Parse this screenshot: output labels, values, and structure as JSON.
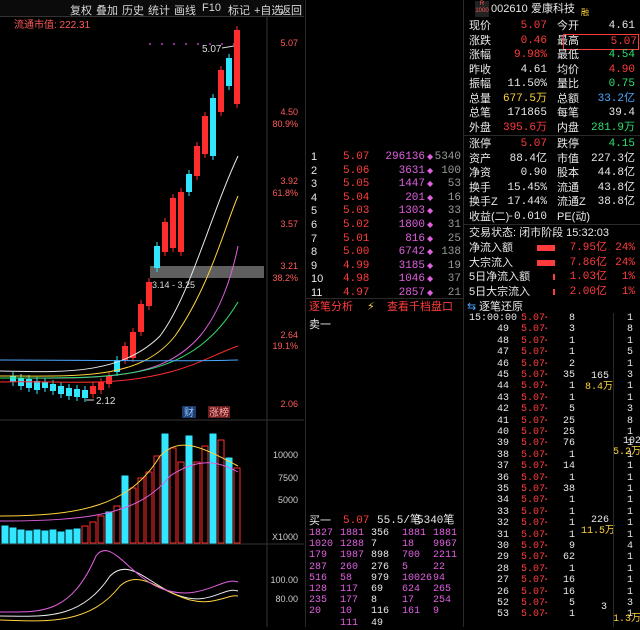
{
  "toolbar": {
    "items": [
      "复权",
      "叠加",
      "历史",
      "统计",
      "画线",
      "F10",
      "标记",
      "+自选",
      "返回"
    ]
  },
  "chart": {
    "market_cap_label": "流通市值: 222.31",
    "price_axis": [
      "5.07",
      "4.50",
      "3.92",
      "3.57",
      "3.21",
      "2.64",
      "2.06"
    ],
    "pct_axis": [
      "80.9%",
      "61.8%",
      "38.2%",
      "19.1%"
    ],
    "high_label": "5.07",
    "low_label": "2.12",
    "range_label": "3.14 - 3.25",
    "badges": [
      "财",
      "涨榜"
    ],
    "vol_axis": [
      "10000",
      "7500",
      "5000"
    ],
    "vol_unit": "X1000",
    "ind_axis": [
      "100.00",
      "80.00"
    ]
  },
  "stock": {
    "code": "002610",
    "name": "爱康科技",
    "badge_r": "R",
    "badge_code": "1000",
    "badge_rong": "融"
  },
  "quote": {
    "rows": [
      [
        {
          "k": "现价",
          "v": "5.07",
          "c": "r"
        },
        {
          "k": "今开",
          "v": "4.61",
          "c": "w"
        }
      ],
      [
        {
          "k": "涨跌",
          "v": "0.46",
          "c": "r"
        },
        {
          "k": "最高",
          "v": "5.07",
          "c": "r",
          "box": true
        }
      ],
      [
        {
          "k": "涨幅",
          "v": "9.98%",
          "c": "r"
        },
        {
          "k": "最低",
          "v": "4.54",
          "c": "g"
        }
      ],
      [
        {
          "k": "昨收",
          "v": "4.61",
          "c": "w"
        },
        {
          "k": "均价",
          "v": "4.90",
          "c": "r"
        }
      ],
      [
        {
          "k": "振幅",
          "v": "11.50%",
          "c": "w"
        },
        {
          "k": "量比",
          "v": "0.75",
          "c": "g"
        }
      ],
      [
        {
          "k": "总量",
          "v": "677.5万",
          "c": "y"
        },
        {
          "k": "总额",
          "v": "33.2亿",
          "c": "b"
        }
      ],
      [
        {
          "k": "总笔",
          "v": "171865",
          "c": "w"
        },
        {
          "k": "每笔",
          "v": "39.4",
          "c": "w"
        }
      ],
      [
        {
          "k": "外盘",
          "v": "395.6万",
          "c": "r"
        },
        {
          "k": "内盘",
          "v": "281.9万",
          "c": "g"
        }
      ]
    ],
    "rows2": [
      [
        {
          "k": "涨停",
          "v": "5.07",
          "c": "r"
        },
        {
          "k": "跌停",
          "v": "4.15",
          "c": "g"
        }
      ],
      [
        {
          "k": "资产",
          "v": "88.4亿",
          "c": "w"
        },
        {
          "k": "市值",
          "v": "227.3亿",
          "c": "w"
        }
      ],
      [
        {
          "k": "净资",
          "v": "0.90",
          "c": "w"
        },
        {
          "k": "股本",
          "v": "44.8亿",
          "c": "w"
        }
      ],
      [
        {
          "k": "换手",
          "v": "15.45%",
          "c": "w"
        },
        {
          "k": "流通",
          "v": "43.8亿",
          "c": "w"
        }
      ],
      [
        {
          "k": "换手Z",
          "v": "17.44%",
          "c": "w"
        },
        {
          "k": "流通Z",
          "v": "38.8亿",
          "c": "w"
        }
      ],
      [
        {
          "k": "收益(二)",
          "v": "-0.010",
          "c": "w"
        },
        {
          "k": "PE(动)",
          "v": "",
          "c": "w"
        }
      ]
    ],
    "status": "交易状态: 闭市阶段 15:32:03",
    "flows": [
      {
        "k": "净流入额",
        "v": "7.95亿",
        "p": "24%",
        "bar": 0.9
      },
      {
        "k": "大宗流入",
        "v": "7.86亿",
        "p": "24%",
        "bar": 0.9
      },
      {
        "k": "5日净流入额",
        "v": "1.03亿",
        "p": "1%",
        "bar": 0.12
      },
      {
        "k": "5日大宗流入",
        "v": "2.00亿",
        "p": "1%",
        "bar": 0.12
      }
    ]
  },
  "buy_book": [
    {
      "lv": "1",
      "p": "5.07",
      "v": "296136",
      "x": "5340"
    },
    {
      "lv": "2",
      "p": "5.06",
      "v": "3631",
      "x": "100"
    },
    {
      "lv": "3",
      "p": "5.05",
      "v": "1447",
      "x": "53"
    },
    {
      "lv": "4",
      "p": "5.04",
      "v": "201",
      "x": "16"
    },
    {
      "lv": "5",
      "p": "5.03",
      "v": "1303",
      "x": "33"
    },
    {
      "lv": "6",
      "p": "5.02",
      "v": "1800",
      "x": "31"
    },
    {
      "lv": "7",
      "p": "5.01",
      "v": "816",
      "x": "25"
    },
    {
      "lv": "8",
      "p": "5.00",
      "v": "6742",
      "x": "138"
    },
    {
      "lv": "9",
      "p": "4.99",
      "v": "3185",
      "x": "19"
    },
    {
      "lv": "10",
      "p": "4.98",
      "v": "1046",
      "x": "37"
    },
    {
      "lv": "11",
      "p": "4.97",
      "v": "2857",
      "x": "21"
    }
  ],
  "tabs": {
    "tick_analysis": "逐笔分析",
    "depth": "查看千档盘口",
    "sell1": "卖一",
    "tick_restore": "逐笔还原"
  },
  "buy1": {
    "label": "买一",
    "price": "5.07",
    "avg": "55.5/笔",
    "count": "5340笔"
  },
  "queue": [
    [
      "1827",
      "1881",
      "356",
      "1881",
      "1881"
    ],
    [
      "1020",
      "1288",
      "7",
      "18",
      "9967"
    ],
    [
      "179",
      "1987",
      "898",
      "700",
      "2211"
    ],
    [
      "287",
      "260",
      "276",
      "5",
      "22"
    ],
    [
      "516",
      "58",
      "979",
      "10026",
      "94"
    ],
    [
      "128",
      "117",
      "69",
      "624",
      "265"
    ],
    [
      "235",
      "177",
      "8",
      "17",
      "254"
    ],
    [
      "20",
      "10",
      "116",
      "161",
      "9"
    ],
    [
      "",
      "111",
      "49",
      "",
      ""
    ]
  ],
  "ticks": {
    "time": "15:00:00",
    "rows": [
      {
        "t": "15:00:00",
        "p": "5.07",
        "v": "8",
        "b": "1"
      },
      {
        "t": "49",
        "p": "5.07",
        "v": "3",
        "b": "8"
      },
      {
        "t": "48",
        "p": "5.07",
        "v": "1",
        "b": "1"
      },
      {
        "t": "47",
        "p": "5.07",
        "v": "1",
        "b": "5"
      },
      {
        "t": "46",
        "p": "5.07",
        "v": "2",
        "b": "1"
      },
      {
        "t": "45",
        "p": "5.07",
        "v": "35",
        "b": "3"
      },
      {
        "t": "44",
        "p": "5.07",
        "v": "1",
        "b": "1"
      },
      {
        "t": "43",
        "p": "5.07",
        "v": "1",
        "b": "1"
      },
      {
        "t": "42",
        "p": "5.07",
        "v": "5",
        "b": "3"
      },
      {
        "t": "41",
        "p": "5.07",
        "v": "25",
        "b": "8"
      },
      {
        "t": "40",
        "p": "5.07",
        "v": "25",
        "b": "1"
      },
      {
        "t": "39",
        "p": "5.07",
        "v": "76",
        "b": "1"
      },
      {
        "t": "38",
        "p": "5.07",
        "v": "1",
        "b": "1"
      },
      {
        "t": "37",
        "p": "5.07",
        "v": "14",
        "b": "1"
      },
      {
        "t": "36",
        "p": "5.07",
        "v": "1",
        "b": "1"
      },
      {
        "t": "35",
        "p": "5.07",
        "v": "38",
        "b": "1"
      },
      {
        "t": "34",
        "p": "5.07",
        "v": "1",
        "b": "1"
      },
      {
        "t": "33",
        "p": "5.07",
        "v": "1",
        "b": "1"
      },
      {
        "t": "32",
        "p": "5.07",
        "v": "1",
        "b": "1"
      },
      {
        "t": "31",
        "p": "5.07",
        "v": "1",
        "b": "1"
      },
      {
        "t": "30",
        "p": "5.07",
        "v": "9",
        "b": "4"
      },
      {
        "t": "29",
        "p": "5.07",
        "v": "62",
        "b": "1"
      },
      {
        "t": "28",
        "p": "5.07",
        "v": "1",
        "b": "1"
      },
      {
        "t": "27",
        "p": "5.07",
        "v": "16",
        "b": "1"
      },
      {
        "t": "26",
        "p": "5.07",
        "v": "16",
        "b": "1"
      },
      {
        "t": "52",
        "p": "5.07",
        "v": "5",
        "b": "3"
      },
      {
        "t": "53",
        "p": "5.07",
        "v": "1",
        "b": "1"
      }
    ],
    "side1": [
      "165",
      "8.4万"
    ],
    "side2": [
      "226",
      "11.5万"
    ],
    "side3": [
      "102",
      "5.2万"
    ],
    "side4": [
      "1.3万"
    ],
    "side5": [
      "3"
    ]
  }
}
